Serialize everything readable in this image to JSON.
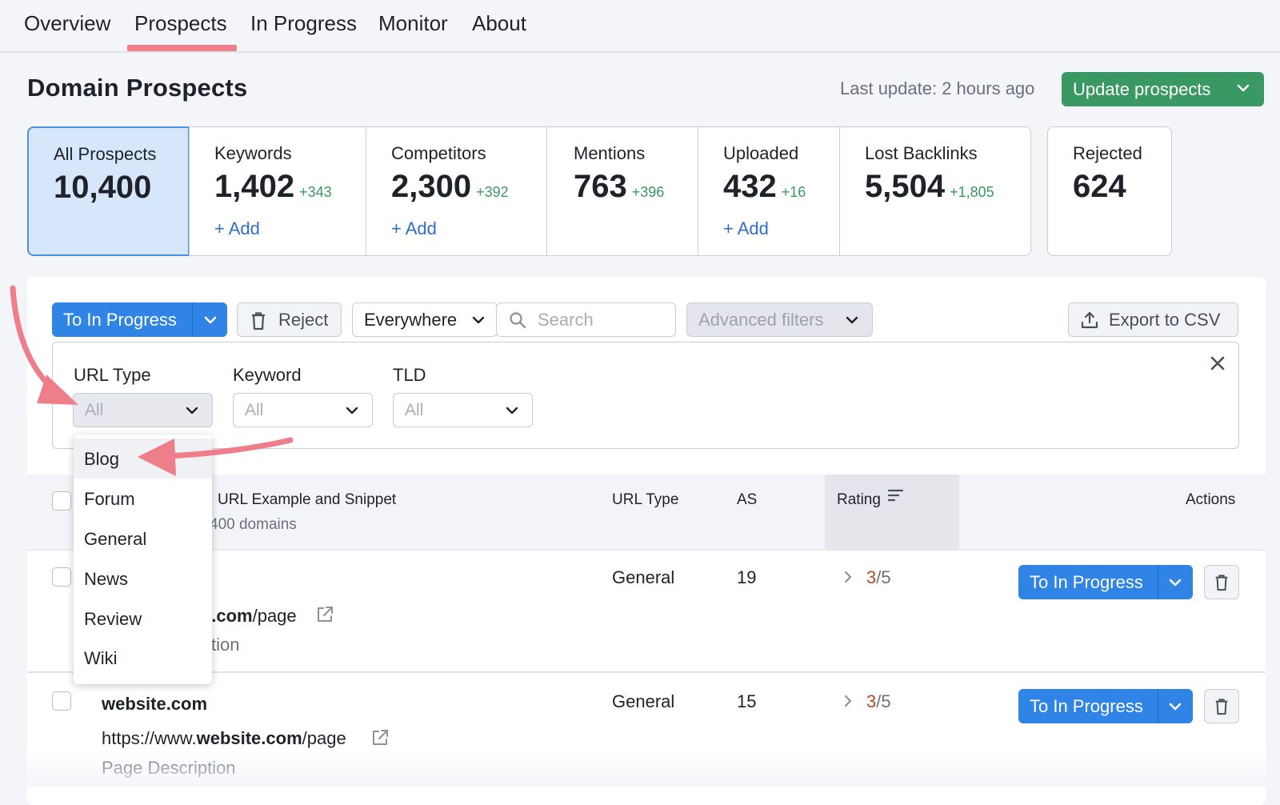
{
  "nav": {
    "tabs": [
      {
        "label": "Overview"
      },
      {
        "label": "Prospects"
      },
      {
        "label": "In Progress"
      },
      {
        "label": "Monitor"
      },
      {
        "label": "About"
      }
    ],
    "active_tab": "Prospects"
  },
  "header": {
    "title": "Domain Prospects",
    "last_update": "Last update: 2 hours ago",
    "update_button": "Update prospects"
  },
  "stats": [
    {
      "label": "All Prospects",
      "value": "10,400",
      "delta": "",
      "add": ""
    },
    {
      "label": "Keywords",
      "value": "1,402",
      "delta": "+343",
      "add": "+ Add"
    },
    {
      "label": "Competitors",
      "value": "2,300",
      "delta": "+392",
      "add": "+ Add"
    },
    {
      "label": "Mentions",
      "value": "763",
      "delta": "+396",
      "add": ""
    },
    {
      "label": "Uploaded",
      "value": "432",
      "delta": "+16",
      "add": "+ Add"
    },
    {
      "label": "Lost Backlinks",
      "value": "5,504",
      "delta": "+1,805",
      "add": ""
    },
    {
      "label": "Rejected",
      "value": "624",
      "delta": "",
      "add": ""
    }
  ],
  "toolbar": {
    "to_in_progress": "To In Progress",
    "reject": "Reject",
    "scope": "Everywhere",
    "search_placeholder": "Search",
    "advanced_filters": "Advanced filters",
    "export": "Export to CSV"
  },
  "filters": {
    "url_type": {
      "label": "URL Type",
      "value": "All"
    },
    "keyword": {
      "label": "Keyword",
      "value": "All"
    },
    "tld": {
      "label": "TLD",
      "value": "All"
    }
  },
  "url_type_menu": [
    "Blog",
    "Forum",
    "General",
    "News",
    "Review",
    "Wiki"
  ],
  "table": {
    "columns": {
      "url": "URL Example and Snippet",
      "url_sub": "400 domains",
      "url_type": "URL Type",
      "as": "AS",
      "rating": "Rating",
      "actions": "Actions"
    },
    "rows": [
      {
        "domain": "",
        "url_partial_bold": "e.com",
        "url_partial_rest": "/page",
        "desc_partial": "tion",
        "url_type": "General",
        "as": "19",
        "rating_value": "3",
        "rating_max": "/5",
        "action": "To In Progress"
      },
      {
        "domain": "website.com",
        "url_prefix": "https://www.",
        "url_bold": "website.com",
        "url_suffix": "/page",
        "desc": "Page Description",
        "url_type": "General",
        "as": "15",
        "rating_value": "3",
        "rating_max": "/5",
        "action": "To In Progress"
      }
    ]
  },
  "colors": {
    "accent_blue": "#2f84e6",
    "brand_green": "#3a9863",
    "highlight_pink": "#ee7f8a",
    "rating_orange": "#b84a1c"
  }
}
